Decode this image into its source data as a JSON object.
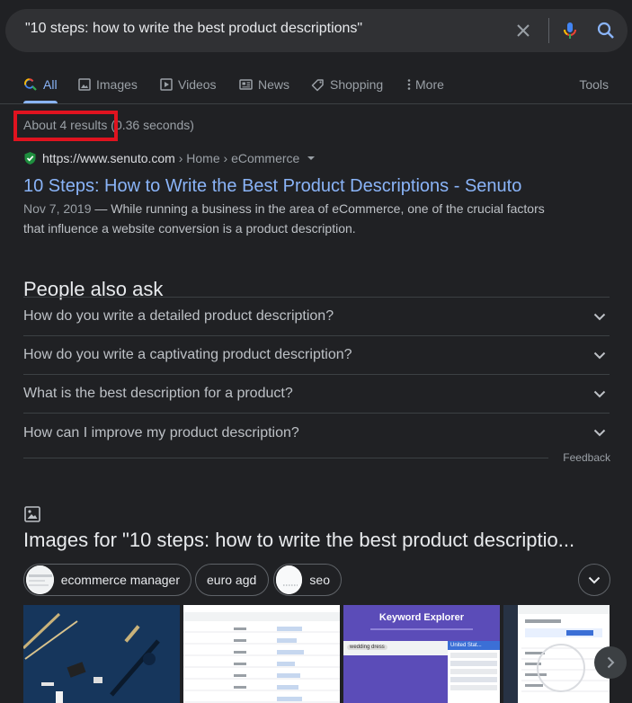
{
  "search": {
    "query": "\"10 steps: how to write the best product descriptions\"",
    "clear_icon": "close-icon",
    "mic_icon": "microphone-icon",
    "search_icon": "search-icon"
  },
  "tabs": [
    {
      "label": "All",
      "icon": "search-icon",
      "active": true
    },
    {
      "label": "Images",
      "icon": "image-icon"
    },
    {
      "label": "Videos",
      "icon": "video-icon"
    },
    {
      "label": "News",
      "icon": "news-icon"
    },
    {
      "label": "Shopping",
      "icon": "tag-icon"
    },
    {
      "label": "More",
      "icon": "more-vert-icon"
    }
  ],
  "tools_label": "Tools",
  "stats": {
    "count": "About 4 results",
    "time": "(0.36 seconds)"
  },
  "result": {
    "host": "https://www.senuto.com",
    "crumbs": " › Home › eCommerce",
    "title": "10 Steps: How to Write the Best Product Descriptions - Senuto",
    "date": "Nov 7, 2019",
    "snippet": " — While running a business in the area of eCommerce, one of the crucial factors that influence a website conversion is a product description."
  },
  "people_also_ask": {
    "title": "People also ask",
    "questions": [
      "How do you write a detailed product description?",
      "How do you write a captivating product description?",
      "What is the best description for a product?",
      "How can I improve my product description?"
    ],
    "feedback": "Feedback"
  },
  "images": {
    "heading": "Images for \"10 steps: how to write the best product descriptio...",
    "chips": [
      "ecommerce manager",
      "euro agd",
      "seo"
    ],
    "keyword_explorer_title": "Keyword Explorer",
    "keyword_tag": "wedding dress",
    "keyword_country": "United Stat..."
  },
  "colors": {
    "background": "#202124",
    "link": "#8ab4f8",
    "highlight": "#e0131f",
    "verified": "#1e8e3e"
  }
}
